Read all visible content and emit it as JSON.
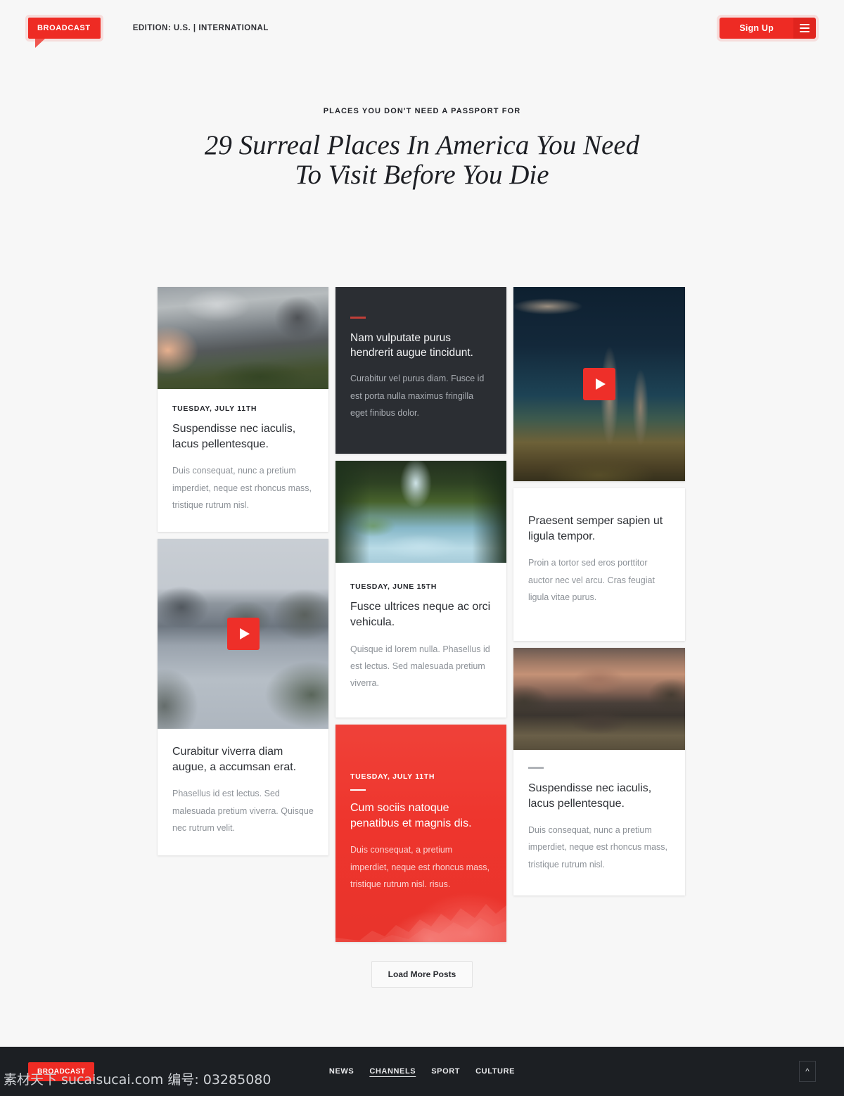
{
  "header": {
    "logo": "BROADCAST",
    "edition": "EDITION: U.S.  |  INTERNATIONAL",
    "signup_label": "Sign Up",
    "menu_icon": "hamburger-menu-icon"
  },
  "hero": {
    "kicker": "PLACES YOU DON'T NEED A PASSPORT FOR",
    "title_line1": "29 Surreal Places In America You Need",
    "title_line2": "To Visit Before You Die"
  },
  "cards": {
    "c1": {
      "date": "TUESDAY, JULY 11TH",
      "title": "Suspendisse nec iaculis, lacus pellentesque.",
      "text": "Duis consequat, nunc a pretium imperdiet, neque est rhoncus mass, tristique rutrum nisl.",
      "image": "mountain-landscape-dramatic-clouds"
    },
    "c2": {
      "title": "Curabitur viverra diam augue, a accumsan erat.",
      "text": "Phasellus id est lectus. Sed malesuada pretium viverra. Quisque nec rutrum velit.",
      "image": "fjord-mountains-video",
      "play_icon": "play-button-icon"
    },
    "c3": {
      "title": "Nam vulputate purus hendrerit augue tincidunt.",
      "text": "Curabitur vel purus diam. Fusce id est porta nulla maximus fringilla eget finibus dolor."
    },
    "c4": {
      "date": "TUESDAY, JUNE 15TH",
      "title": "Fusce ultrices neque ac orci vehicula.",
      "text": "Quisque id lorem nulla. Phasellus id est lectus. Sed malesuada pretium viverra.",
      "image": "waterfall-mossy-river"
    },
    "c5": {
      "date": "TUESDAY, JULY 11TH",
      "title": "Cum sociis natoque penatibus et magnis dis.",
      "text": "Duis consequat, a pretium imperdiet, neque est rhoncus mass, tristique rutrum nisl. risus."
    },
    "c6": {
      "title": "Praesent semper sapien ut ligula tempor.",
      "text": "Proin a tortor sed eros porttitor auctor nec vel arcu. Cras feugiat ligula vitae purus.",
      "image": "dead-trees-twilight-video",
      "play_icon": "play-button-icon"
    },
    "c7": {
      "title": "Suspendisse nec iaculis, lacus pellentesque.",
      "text": "Duis consequat, nunc a pretium imperdiet, neque est rhoncus mass, tristique rutrum nisl.",
      "image": "sunset-mountain-lake-reflection"
    }
  },
  "load_more": {
    "label": "Load More Posts"
  },
  "footer": {
    "logo": "BROADCAST",
    "nav": [
      {
        "label": "NEWS",
        "active": false
      },
      {
        "label": "CHANNELS",
        "active": true
      },
      {
        "label": "SPORT",
        "active": false
      },
      {
        "label": "CULTURE",
        "active": false
      }
    ],
    "back_to_top_icon": "chevron-up-icon"
  },
  "watermark": "素材天下 sucaisucai.com 编号: 03285080",
  "colors": {
    "accent_red": "#ee2b24",
    "card_red": "#ef3b33",
    "dark_card": "#2b2e33",
    "footer_bg": "#1c1f23",
    "page_bg": "#f7f7f7"
  }
}
